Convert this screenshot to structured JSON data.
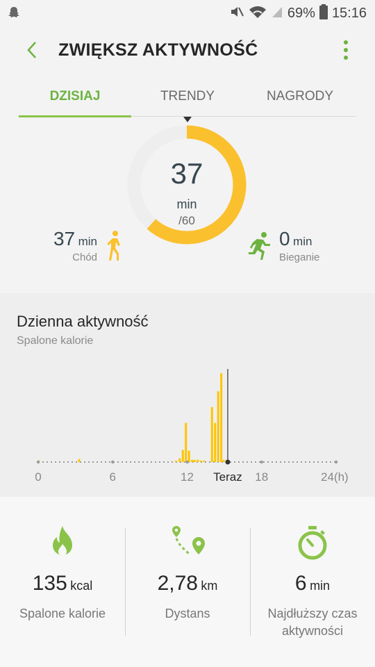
{
  "status_bar": {
    "battery": "69%",
    "time": "15:16"
  },
  "header": {
    "title": "ZWIĘKSZ AKTYWNOŚĆ"
  },
  "tabs": [
    {
      "label": "DZISIAJ",
      "active": true
    },
    {
      "label": "TRENDY",
      "active": false
    },
    {
      "label": "NAGRODY",
      "active": false
    }
  ],
  "ring": {
    "value": "37",
    "unit": "min",
    "goal": "/60",
    "progress": 0.617
  },
  "walk": {
    "value": "37",
    "unit": "min",
    "label": "Chód"
  },
  "run": {
    "value": "0",
    "unit": "min",
    "label": "Bieganie"
  },
  "daily_activity": {
    "title": "Dzienna aktywność",
    "subtitle": "Spalone kalorie"
  },
  "chart_data": {
    "type": "bar",
    "title": "Dzienna aktywność",
    "ylabel": "Spalone kalorie",
    "xlim": [
      0,
      24
    ],
    "tick_labels": [
      "0",
      "6",
      "12",
      "Teraz",
      "18",
      "24(h)"
    ],
    "tick_hours": [
      0,
      6,
      12,
      15.27,
      18,
      24
    ],
    "now_hour": 15.27,
    "x": [
      0.05,
      3.3,
      11.1,
      11.4,
      11.65,
      11.9,
      12.15,
      12.4,
      12.6,
      12.85,
      13.1,
      13.35,
      14.0,
      14.25,
      14.5,
      14.75,
      14.95
    ],
    "values": [
      2,
      4,
      1,
      5,
      16,
      52,
      15,
      3,
      3,
      3,
      2,
      2,
      73,
      52,
      94,
      118,
      3
    ],
    "colors": {
      "bar": "#ffc400",
      "axis": "#9a9a9a",
      "now": "#333333"
    }
  },
  "stats": [
    {
      "icon": "flame-icon",
      "value": "135",
      "unit": "kcal",
      "label": "Spalone kalorie"
    },
    {
      "icon": "route-icon",
      "value": "2,78",
      "unit": "km",
      "label": "Dystans"
    },
    {
      "icon": "stopwatch-icon",
      "value": "6",
      "unit": "min",
      "label_line1": "Najdłuższy czas",
      "label_line2": "aktywności"
    }
  ],
  "colors": {
    "accent_green": "#8bc34a",
    "ring_yellow": "#fbc02d",
    "ring_track": "#eeeeee"
  }
}
